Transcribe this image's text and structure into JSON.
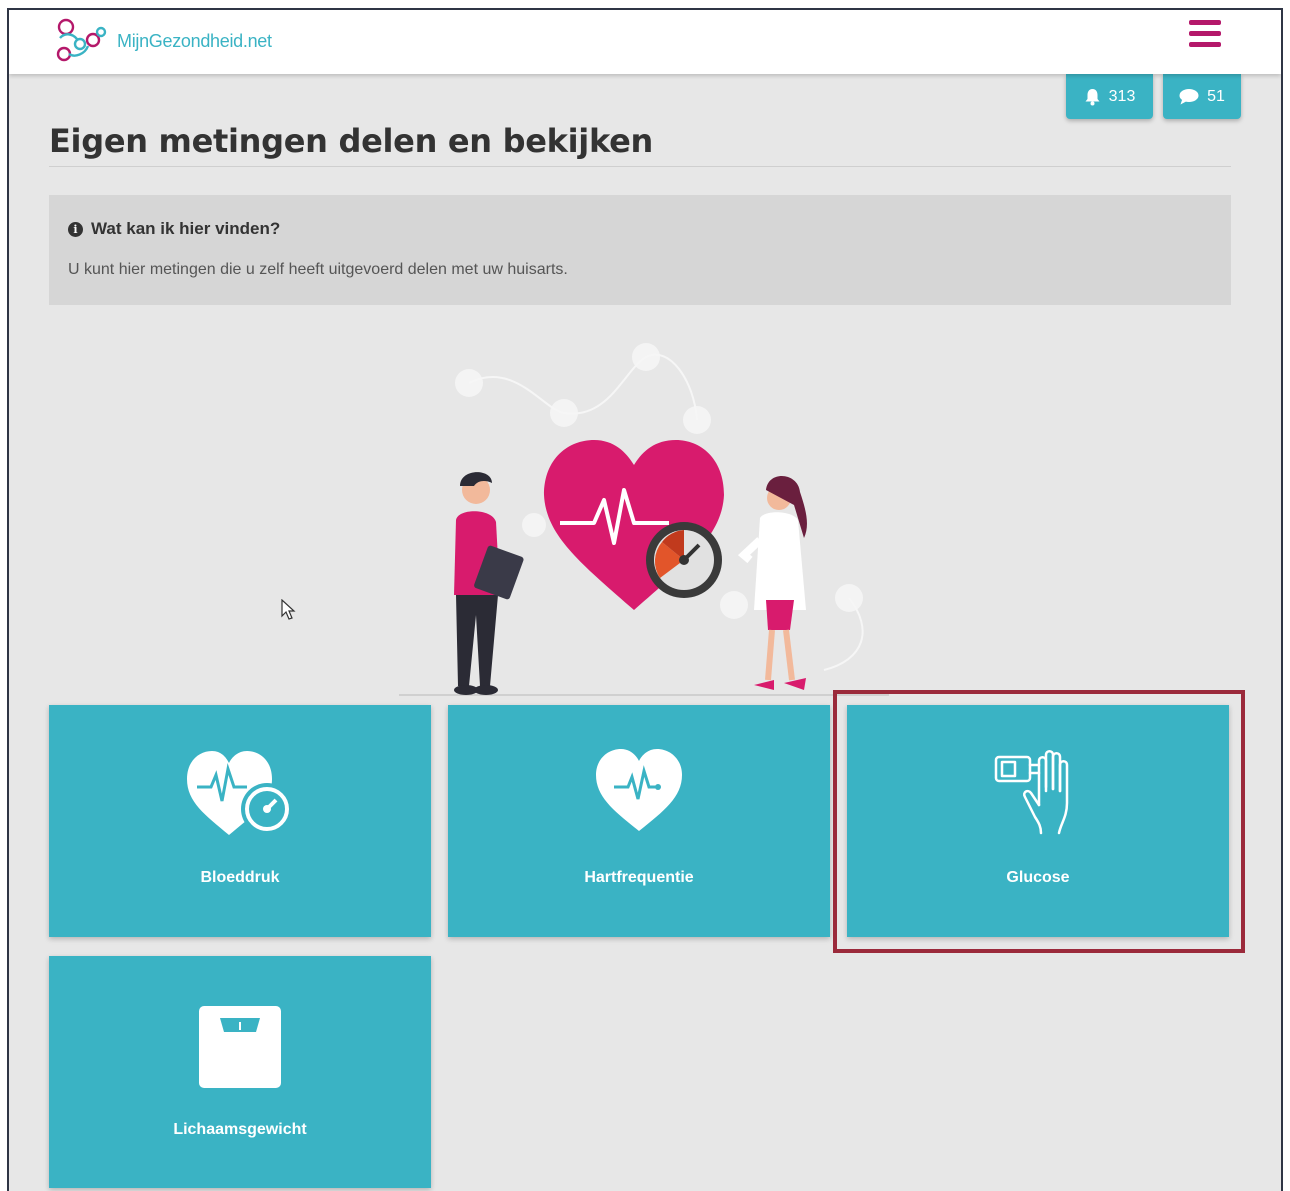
{
  "header": {
    "logo_text": "MijnGezondheid.net",
    "menu_icon": "hamburger-menu-icon"
  },
  "badges": {
    "notifications": {
      "icon": "bell-icon",
      "count": "313"
    },
    "messages": {
      "icon": "speech-bubble-icon",
      "count": "51"
    }
  },
  "page": {
    "title": "Eigen metingen delen en bekijken"
  },
  "info": {
    "heading": "Wat kan ik hier vinden?",
    "text": "U kunt hier metingen die u zelf heeft uitgevoerd delen met uw huisarts."
  },
  "tiles": [
    {
      "label": "Bloeddruk",
      "icon": "heart-pulse-gauge-icon"
    },
    {
      "label": "Hartfrequentie",
      "icon": "heart-pulse-icon"
    },
    {
      "label": "Glucose",
      "icon": "glucose-meter-hand-icon"
    },
    {
      "label": "Lichaamsgewicht",
      "icon": "weighing-scale-icon"
    }
  ],
  "colors": {
    "accent": "#3ab3c4",
    "brand": "#b4186a",
    "heart": "#d81b6d",
    "highlight_border": "#9b2a3b",
    "background": "#e7e7e7"
  }
}
